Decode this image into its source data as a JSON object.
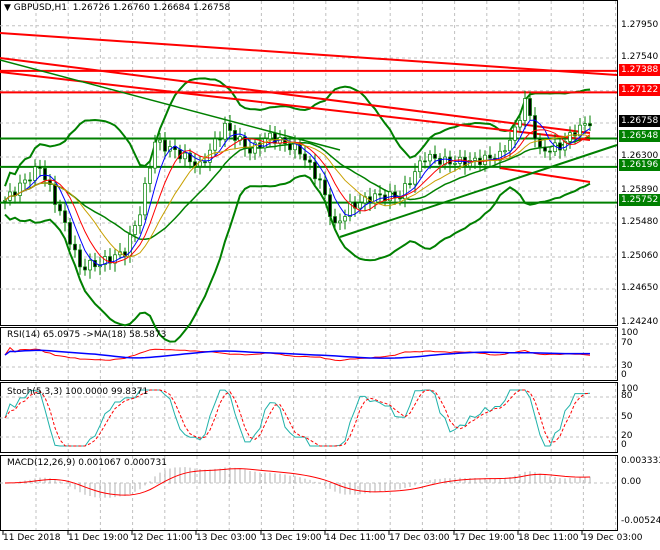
{
  "header": {
    "symbol": "GBPUSD,H1",
    "open": "1.26726",
    "high": "1.26760",
    "low": "1.26684",
    "close": "1.26758"
  },
  "price_axis": [
    "1.27950",
    "1.27540",
    "1.26300",
    "1.25890",
    "1.25480",
    "1.25060",
    "1.24650",
    "1.24240"
  ],
  "price_labels": [
    {
      "value": "1.27388",
      "color": "#ff0000"
    },
    {
      "value": "1.27122",
      "color": "#ff0000"
    },
    {
      "value": "1.26758",
      "color": "#000000"
    },
    {
      "value": "1.26548",
      "color": "#008000"
    },
    {
      "value": "1.26196",
      "color": "#008000"
    },
    {
      "value": "1.25752",
      "color": "#008000"
    }
  ],
  "rsi": {
    "label": "RSI(14) 65.0975  ->MA(18) 58.5873",
    "axis": [
      "100",
      "70",
      "30",
      "0"
    ]
  },
  "stoch": {
    "label": "Stoch(5,3,3) 100.0000 99.8371",
    "axis": [
      "100",
      "80",
      "50",
      "20",
      "0"
    ]
  },
  "macd": {
    "label": "MACD(12,26,9) 0.001067 0.000731",
    "axis": [
      "0.003333",
      "0.00",
      "-0.00524"
    ]
  },
  "time_axis": [
    "11 Dec 2018",
    "11 Dec 19:00",
    "12 Dec 11:00",
    "13 Dec 03:00",
    "13 Dec 19:00",
    "14 Dec 11:00",
    "17 Dec 03:00",
    "17 Dec 19:00",
    "18 Dec 11:00",
    "19 Dec 03:00"
  ],
  "chart_data": {
    "type": "candlestick",
    "title": "GBPUSD,H1",
    "key_closes": [
      [
        0,
        1.2578
      ],
      [
        7,
        1.262
      ],
      [
        11,
        1.2564
      ],
      [
        15,
        1.2495
      ],
      [
        19,
        1.25
      ],
      [
        24,
        1.2514
      ],
      [
        27,
        1.2564
      ],
      [
        30,
        1.2651
      ],
      [
        34,
        1.2639
      ],
      [
        39,
        1.262
      ],
      [
        44,
        1.267
      ],
      [
        49,
        1.2639
      ],
      [
        53,
        1.2658
      ],
      [
        59,
        1.2639
      ],
      [
        63,
        1.2601
      ],
      [
        66,
        1.2545
      ],
      [
        69,
        1.257
      ],
      [
        74,
        1.2583
      ],
      [
        79,
        1.2583
      ],
      [
        84,
        1.2633
      ],
      [
        88,
        1.2626
      ],
      [
        93,
        1.2626
      ],
      [
        99,
        1.2633
      ],
      [
        102,
        1.2664
      ],
      [
        104,
        1.2702
      ],
      [
        107,
        1.2639
      ],
      [
        111,
        1.2645
      ],
      [
        114,
        1.2664
      ],
      [
        117,
        1.2676
      ]
    ],
    "horizontal_levels": {
      "resistance": [
        1.27388,
        1.27122
      ],
      "support": [
        1.26548,
        1.26196,
        1.25752
      ]
    },
    "ylim": [
      1.2424,
      1.2795
    ]
  }
}
